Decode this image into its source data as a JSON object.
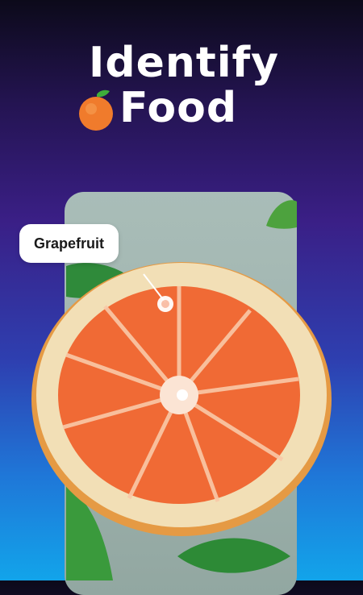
{
  "headline": {
    "line1": "Identify",
    "line2": "Food"
  },
  "icons": {
    "title_icon": "orange-fruit-icon"
  },
  "detection": {
    "label": "Grapefruit"
  },
  "colors": {
    "background_top": "#0c0a1a",
    "background_mid": "#3a1f86",
    "background_bottom": "#12a4ea",
    "label_background": "#ffffff"
  }
}
